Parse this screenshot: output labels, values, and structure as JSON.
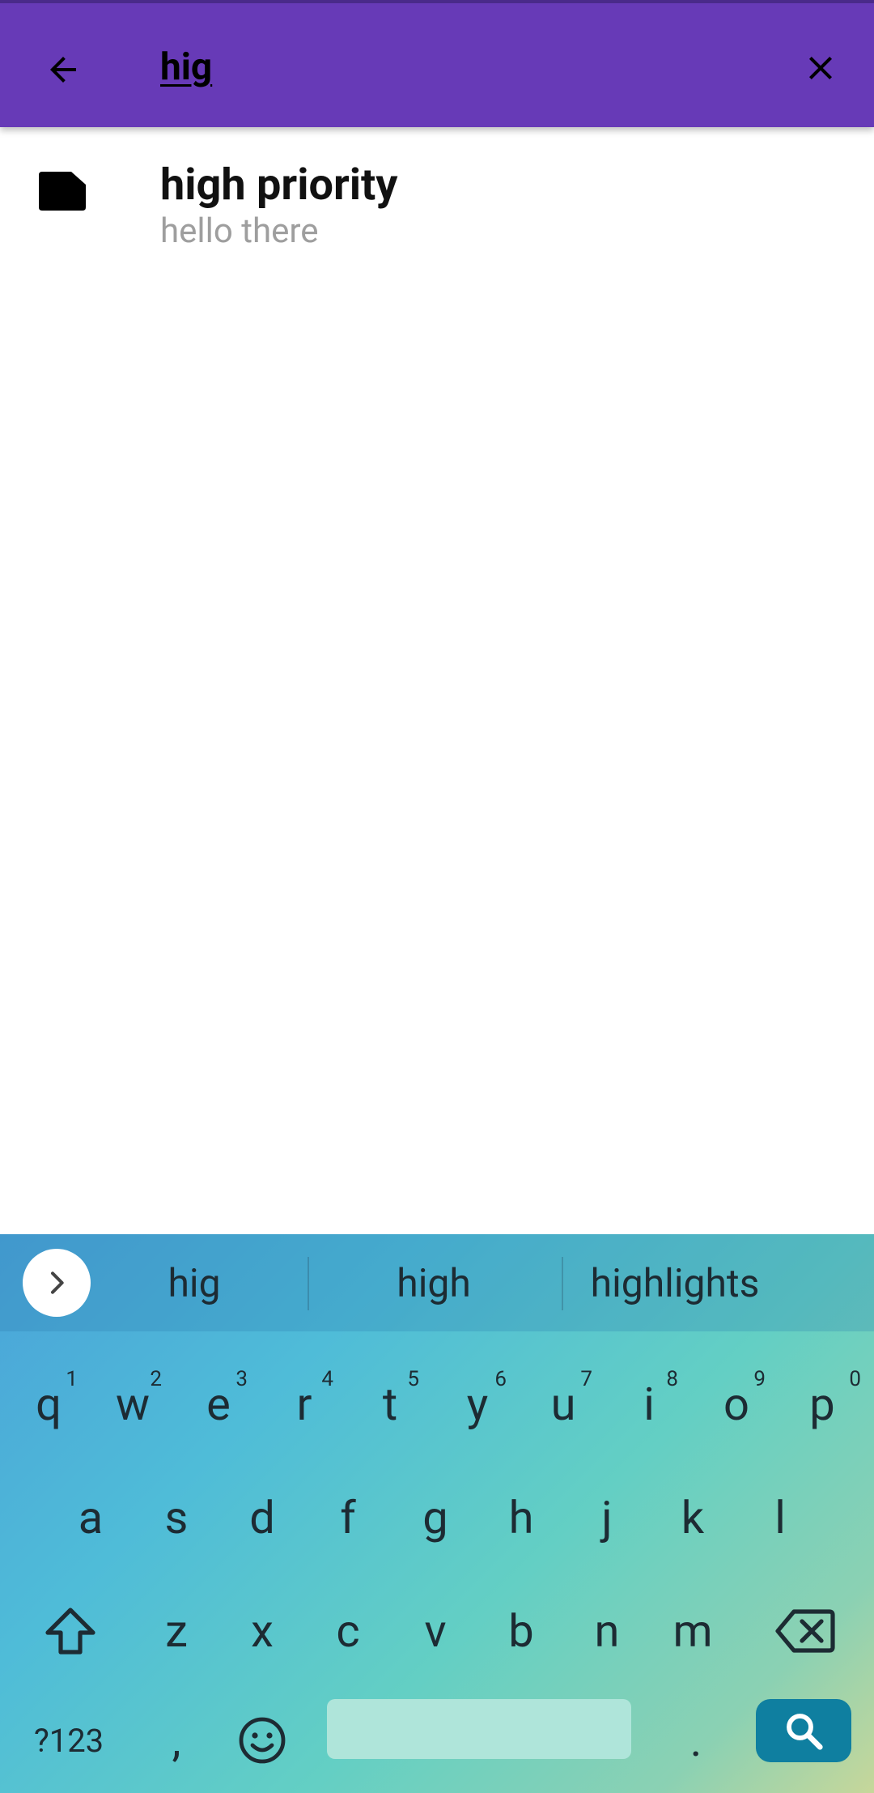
{
  "search": {
    "query": "hig"
  },
  "results": [
    {
      "title": "high priority",
      "snippet": "hello there"
    }
  ],
  "keyboard": {
    "suggestions": [
      "hig",
      "high",
      "highlights"
    ],
    "row1": [
      {
        "key": "q",
        "hint": "1"
      },
      {
        "key": "w",
        "hint": "2"
      },
      {
        "key": "e",
        "hint": "3"
      },
      {
        "key": "r",
        "hint": "4"
      },
      {
        "key": "t",
        "hint": "5"
      },
      {
        "key": "y",
        "hint": "6"
      },
      {
        "key": "u",
        "hint": "7"
      },
      {
        "key": "i",
        "hint": "8"
      },
      {
        "key": "o",
        "hint": "9"
      },
      {
        "key": "p",
        "hint": "0"
      }
    ],
    "row2": [
      "a",
      "s",
      "d",
      "f",
      "g",
      "h",
      "j",
      "k",
      "l"
    ],
    "row3": [
      "z",
      "x",
      "c",
      "v",
      "b",
      "n",
      "m"
    ],
    "symbols_label": "?123",
    "comma": ",",
    "period": "."
  },
  "colors": {
    "appbar": "#673ab7",
    "search_key": "#0f7fa0",
    "snippet_text": "#9e9e9e"
  },
  "icons": {
    "back": "arrow-left-icon",
    "clear": "close-icon",
    "note": "note-icon",
    "expand": "chevron-right-icon",
    "shift": "shift-icon",
    "backspace": "backspace-icon",
    "emoji": "emoji-icon",
    "search": "search-icon"
  }
}
